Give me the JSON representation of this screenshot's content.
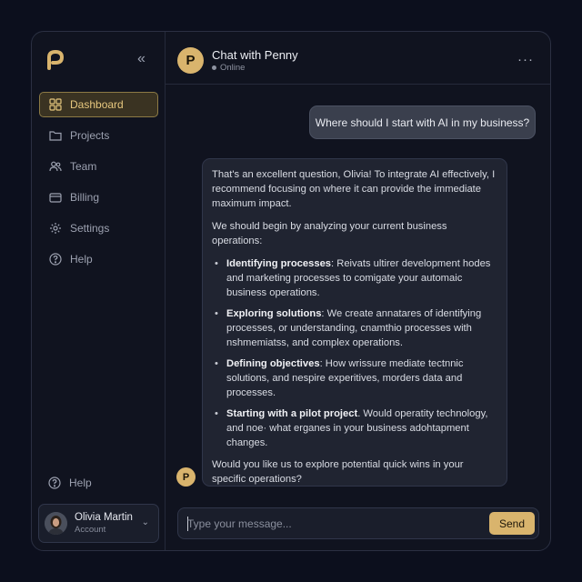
{
  "sidebar": {
    "items": [
      {
        "label": "Dashboard",
        "icon": "dashboard-icon",
        "active": true
      },
      {
        "label": "Projects",
        "icon": "folder-icon"
      },
      {
        "label": "Team",
        "icon": "team-icon"
      },
      {
        "label": "Billing",
        "icon": "card-icon"
      },
      {
        "label": "Settings",
        "icon": "gear-icon"
      },
      {
        "label": "Help",
        "icon": "help-icon"
      }
    ],
    "help_bottom": "Help",
    "user": {
      "name": "Olivia Martin",
      "role": "Account"
    }
  },
  "header": {
    "avatar_letter": "P",
    "title": "Chat with Penny",
    "status": "Online"
  },
  "messages": {
    "user": "Where should I start with AI in my business?",
    "bot": {
      "avatar_letter": "P",
      "intro": "That's an excellent question, Olivia! To integrate AI effectively, I recommend focusing on where it can provide the immediate maximum impact.",
      "lead": "We should begin by analyzing your current business operations:",
      "bullets": [
        {
          "title": "Identifying processes",
          "text": ": Reivats ultirer development hodes and marketing processes to comigate your automaic business operations."
        },
        {
          "title": "Exploring solutions",
          "text": ": We create annatares of identifying processes, or understanding, cnamthio processes with nshmemiatss, and complex operations."
        },
        {
          "title": "Defining objectives",
          "text": ": How wrissure mediate tectnnic solutions, and nespire experitives, morders data and processes."
        },
        {
          "title": "Starting with a pilot project",
          "text": ". Would operatity technology, and noe· what erganes in your business adohtapment changes."
        }
      ],
      "closing": "Would you like us to explore potential quick wins in your specific operations?"
    }
  },
  "composer": {
    "placeholder": "Type your message...",
    "send_label": "Send"
  },
  "colors": {
    "accent": "#d9b46d",
    "background": "#0c0f1d",
    "panel": "#10131f"
  }
}
